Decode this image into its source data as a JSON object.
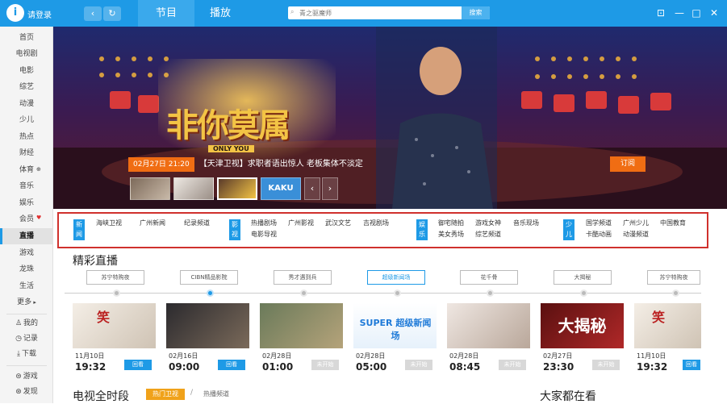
{
  "header": {
    "login": "请登录",
    "tabs": [
      "节目",
      "播放"
    ],
    "search_placeholder": "青之驱魔师",
    "search_button": "搜索"
  },
  "sidebar": {
    "items": [
      "首页",
      "电视剧",
      "电影",
      "综艺",
      "动漫",
      "少儿",
      "热点",
      "财经",
      "体育",
      "音乐",
      "娱乐",
      "会员",
      "直播",
      "游戏",
      "龙珠",
      "生活",
      "更多"
    ],
    "active": "直播",
    "bottom_items": [
      "我的",
      "记录",
      "下载",
      "游戏",
      "发现"
    ]
  },
  "banner": {
    "show_time": "02月27日 21:20",
    "caption": "【天津卫视】求职者语出惊人 老板集体不淡定",
    "follow_button": "订阅",
    "logo_text": "非你莫属",
    "logo_sub": "ONLY YOU",
    "thumb_text": "KAKU"
  },
  "categories": [
    {
      "label": "新闻",
      "links": [
        "海峡卫视",
        "广州新闻",
        "纪录频道"
      ]
    },
    {
      "label": "影视",
      "links": [
        "热播剧场",
        "广州影视",
        "武汉文艺",
        "吉视剧场",
        "电影导视"
      ]
    },
    {
      "label": "娱乐",
      "links": [
        "御宅随拍",
        "游戏女神",
        "音乐现场",
        "美女秀场",
        "综艺频道"
      ]
    },
    {
      "label": "少儿",
      "links": [
        "国学频道",
        "广州少儿",
        "中国教育",
        "卡酷动画",
        "动漫频道"
      ]
    }
  ],
  "live": {
    "title": "精彩直播",
    "channels": [
      "苏宁特购夜",
      "CIBN精品影院",
      "秀才遇到兵",
      "超级新闻场",
      "花千骨",
      "大揭秘",
      "苏宁特购夜"
    ],
    "active_channel": "超级新闻场",
    "programs": [
      {
        "date": "11月10日",
        "time": "19:32",
        "status": "回看",
        "kind": "replay"
      },
      {
        "date": "02月16日",
        "time": "09:00",
        "status": "回看",
        "kind": "replay"
      },
      {
        "date": "02月28日",
        "time": "01:00",
        "status": "未开始",
        "kind": "pending"
      },
      {
        "date": "02月28日",
        "time": "05:00",
        "status": "未开始",
        "kind": "pending"
      },
      {
        "date": "02月28日",
        "time": "08:45",
        "status": "未开始",
        "kind": "pending"
      },
      {
        "date": "02月27日",
        "time": "23:30",
        "status": "未开始",
        "kind": "pending"
      },
      {
        "date": "11月10日",
        "time": "19:32",
        "status": "回看",
        "kind": "replay"
      }
    ],
    "thumb_text": [
      "笑",
      "",
      "",
      "SUPER 超级新闻场",
      "",
      "大揭秘",
      "笑"
    ]
  },
  "bottom": {
    "tv_title": "电视全时段",
    "hot_tab": "热门卫视",
    "sub_tab": "热播频道",
    "watch_title": "大家都在看"
  },
  "colors": {
    "accent": "#1e9ae6",
    "orange": "#f06d13",
    "highlight_box": "#d0312d"
  }
}
